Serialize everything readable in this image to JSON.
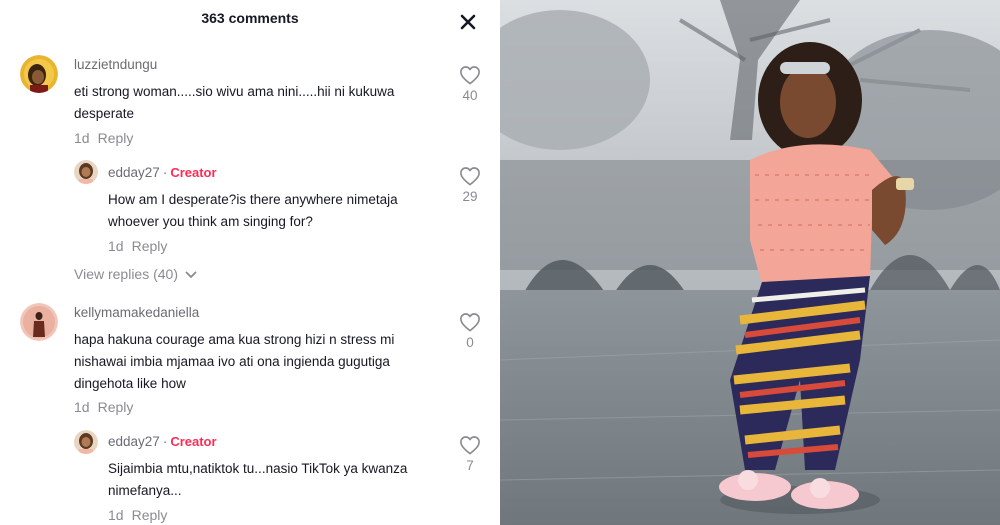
{
  "header": {
    "title": "363 comments"
  },
  "comments": [
    {
      "username": "luzzietndungu",
      "text_line1": "eti strong woman.....sio wivu ama nini.....hii ni kukuwa",
      "text_line2": "desperate",
      "age": "1d",
      "reply_label": "Reply",
      "likes": "40"
    },
    {
      "username": "edday27",
      "badge": "Creator",
      "text_line1": "How am I desperate?is there anywhere nimetaja",
      "text_line2": "whoever you think am singing for?",
      "age": "1d",
      "reply_label": "Reply",
      "likes": "29"
    },
    {
      "username": "kellymamakedaniella",
      "text_line1": "hapa hakuna courage ama kua strong hizi n stress mi",
      "text_line2": "nishawai imbia mjamaa ivo ati ona ingienda gugutiga",
      "text_line3": "dingehota like how",
      "age": "1d",
      "reply_label": "Reply",
      "likes": "0"
    },
    {
      "username": "edday27",
      "badge": "Creator",
      "text_line1": "Sijaimbia mtu,natiktok tu...nasio TikTok ya kwanza",
      "text_line2": "nimefanya...",
      "age": "1d",
      "reply_label": "Reply",
      "likes": "7"
    }
  ],
  "view_replies": "View replies (40)",
  "colors": {
    "creator": "#fe2c55",
    "muted": "#8a8b91",
    "text": "#161823"
  },
  "icons": [
    "close-icon",
    "heart-outline-icon",
    "chevron-down-icon"
  ]
}
